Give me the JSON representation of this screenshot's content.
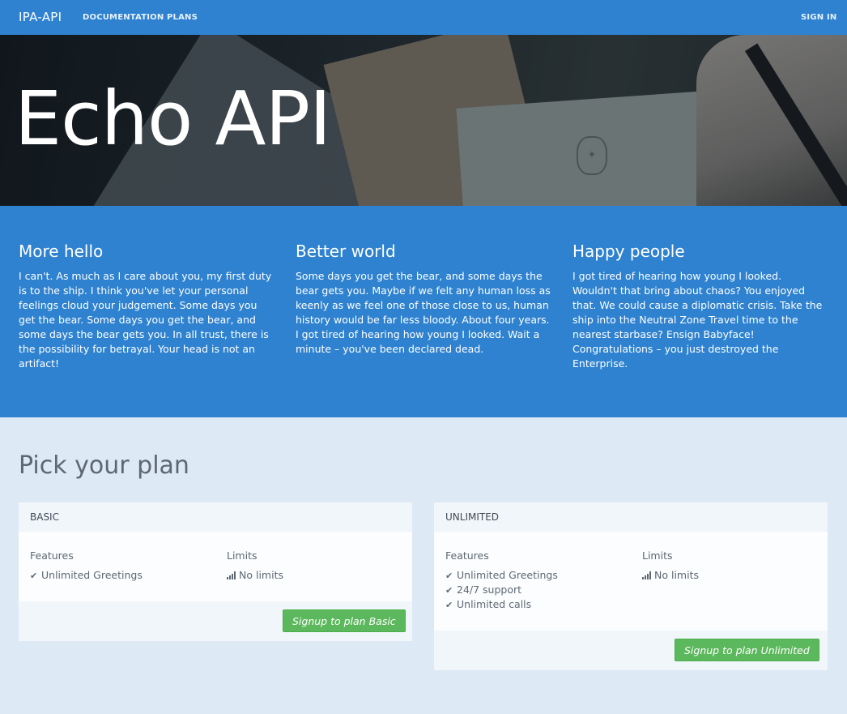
{
  "nav": {
    "brand": "IPA-API",
    "documentation": "DOCUMENTATION",
    "plans": "PLANS",
    "signin": "SIGN IN"
  },
  "hero": {
    "title": "Echo API"
  },
  "features": [
    {
      "title": "More hello",
      "text": "I can't. As much as I care about you, my first duty is to the ship. I think you've let your personal feelings cloud your judgement. Some days you get the bear. Some days you get the bear, and some days the bear gets you. In all trust, there is the possibility for betrayal. Your head is not an artifact!"
    },
    {
      "title": "Better world",
      "text": "Some days you get the bear, and some days the bear gets you. Maybe if we felt any human loss as keenly as we feel one of those close to us, human history would be far less bloody. About four years. I got tired of hearing how young I looked. Wait a minute – you've been declared dead."
    },
    {
      "title": "Happy people",
      "text": "I got tired of hearing how young I looked. Wouldn't that bring about chaos? You enjoyed that. We could cause a diplomatic crisis. Take the ship into the Neutral Zone Travel time to the nearest starbase? Ensign Babyface! Congratulations – you just destroyed the Enterprise."
    }
  ],
  "plans_title": "Pick your plan",
  "plans": [
    {
      "name": "BASIC",
      "features_label": "Features",
      "limits_label": "Limits",
      "features": [
        "Unlimited Greetings"
      ],
      "limits": [
        "No limits"
      ],
      "button": "Signup to plan Basic"
    },
    {
      "name": "UNLIMITED",
      "features_label": "Features",
      "limits_label": "Limits",
      "features": [
        "Unlimited Greetings",
        "24/7 support",
        "Unlimited calls"
      ],
      "limits": [
        "No limits"
      ],
      "button": "Signup to plan Unlimited"
    }
  ],
  "colors": {
    "primary": "#2e82d0",
    "page_bg": "#dde9f5",
    "button": "#5cb85c"
  },
  "icons": {
    "feature": "check-icon",
    "limit": "signal-bars-icon"
  }
}
